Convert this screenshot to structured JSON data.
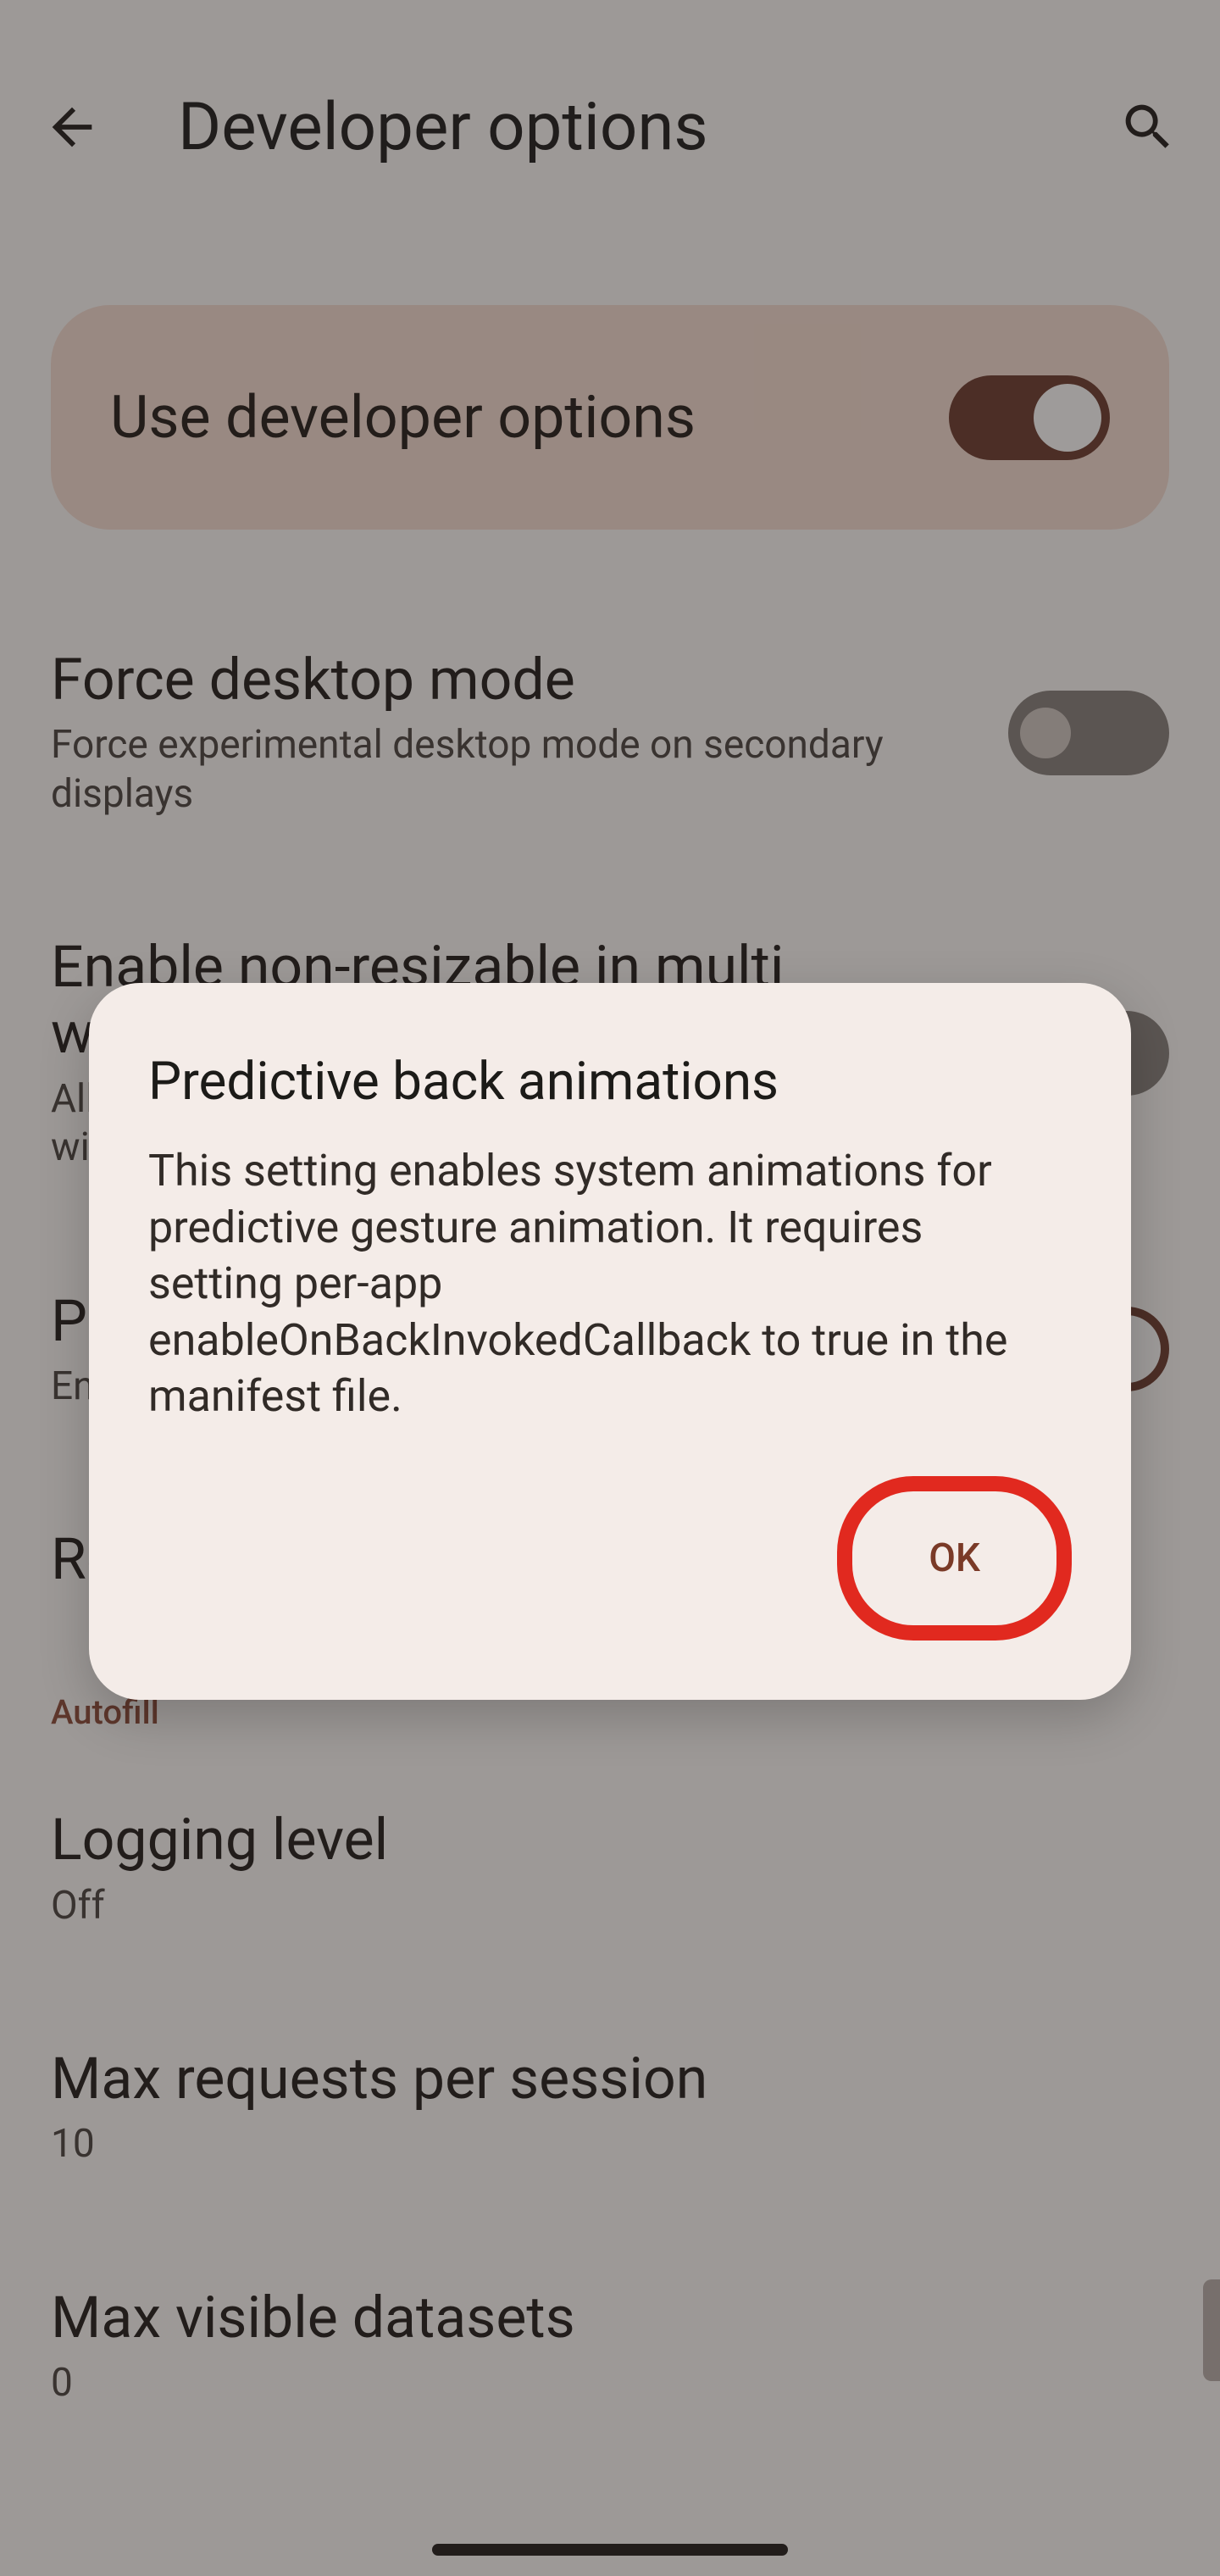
{
  "header": {
    "title": "Developer options"
  },
  "master": {
    "label": "Use developer options",
    "on": true
  },
  "settings": [
    {
      "title": "Force desktop mode",
      "sub": "Force experimental desktop mode on secondary displays",
      "switch": "off"
    },
    {
      "title": "Enable non-resizable in multi window",
      "sub": "Allows non-resizable apps to be shown in multi window",
      "switch": "off"
    },
    {
      "title": "Predictive back animations",
      "sub": "Enable system animations for predictive back",
      "switch": "on"
    },
    {
      "title": "Reset ShortcutManager rate-limiting",
      "sub": ""
    }
  ],
  "category": "Autofill",
  "autofill": [
    {
      "title": "Logging level",
      "sub": "Off"
    },
    {
      "title": "Max requests per session",
      "sub": "10"
    },
    {
      "title": "Max visible datasets",
      "sub": "0"
    }
  ],
  "dialog": {
    "title": "Predictive back animations",
    "body": "This setting enables system animations for predictive gesture animation. It requires setting per-app enableOnBackInvokedCallback to true in the manifest file.",
    "ok_label": "OK"
  }
}
